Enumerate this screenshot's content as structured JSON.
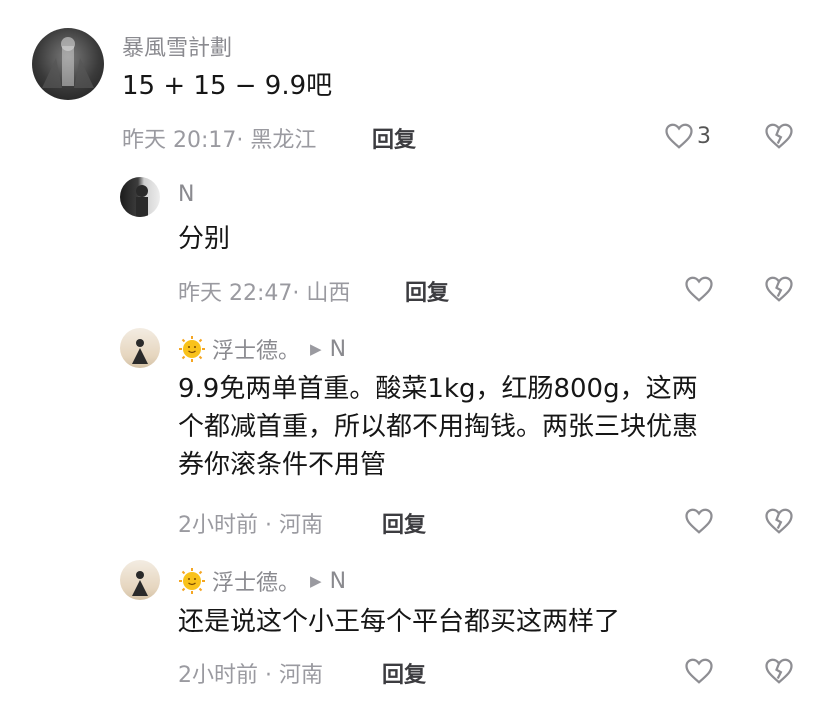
{
  "comments": [
    {
      "username": "暴風雪計劃",
      "text": "15 + 15 − 9.9吧",
      "time": "昨天 20:17",
      "location": "黑龙江",
      "reply_label": "回复",
      "likes": "3"
    },
    {
      "username": "N",
      "text": "分别",
      "time": "昨天 22:47",
      "location": "山西",
      "reply_label": "回复"
    },
    {
      "username": "浮士德。",
      "reply_to": "N",
      "text_lines": [
        "9.9免两单首重。酸菜1kg，红肠800g，这两",
        "个都减首重，所以都不用掏钱。两张三块优惠",
        "券你滚条件不用管"
      ],
      "time": "2小时前",
      "location": "河南",
      "reply_label": "回复"
    },
    {
      "username": "浮士德。",
      "reply_to": "N",
      "text": "还是说这个小王每个平台都买这两样了",
      "time": "2小时前",
      "location": "河南",
      "reply_label": "回复"
    }
  ],
  "icons": {
    "like": "heart-outline-icon",
    "dislike": "broken-heart-icon",
    "reply_arrow": "play-arrow-icon",
    "emoji": "sun-face-emoji"
  },
  "colors": {
    "text": "#161616",
    "meta": "#9a9aa0",
    "username": "#8a8a8f"
  }
}
